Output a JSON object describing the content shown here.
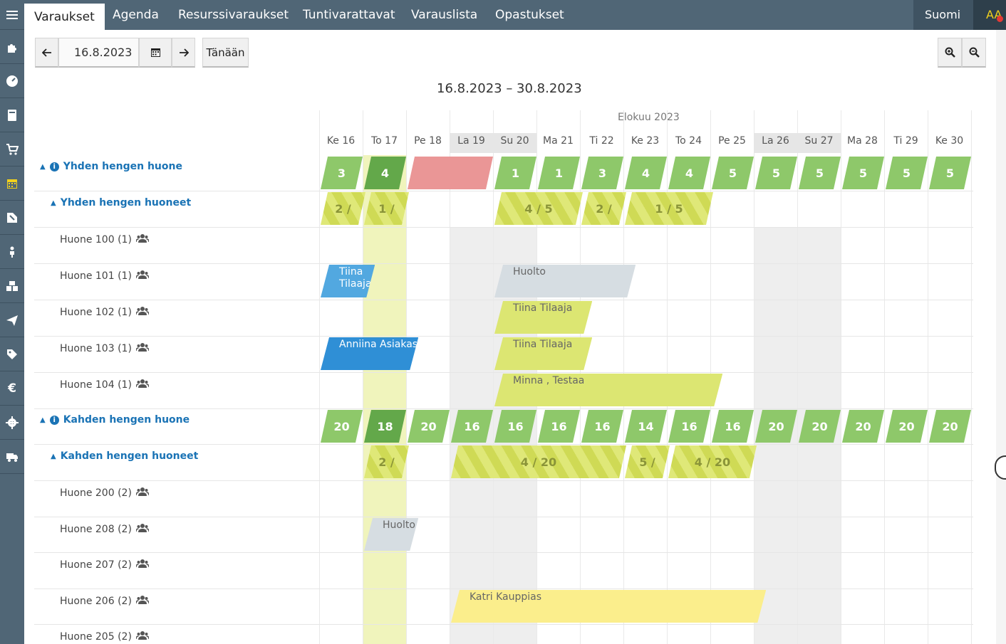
{
  "nav": {
    "tabs": [
      "Varaukset",
      "Agenda",
      "Resurssivaraukset",
      "Tuntivarattavat",
      "Varauslista",
      "Opastukset"
    ],
    "language": "Suomi",
    "user_initials": "AA"
  },
  "toolbar": {
    "date": "16.8.2023",
    "today_label": "Tänään"
  },
  "calendar": {
    "range_title": "16.8.2023 – 30.8.2023",
    "month_label": "Elokuu 2023",
    "days": [
      "Ke 16",
      "To 17",
      "Pe 18",
      "La 19",
      "Su 20",
      "Ma 21",
      "Ti 22",
      "Ke 23",
      "To 24",
      "Pe 25",
      "La 26",
      "Su 27",
      "Ma 28",
      "Ti 29",
      "Ke 30"
    ],
    "weekend_days": [
      "La 19",
      "Su 20",
      "La 26",
      "Su 27"
    ],
    "today": "To 17"
  },
  "groups": [
    {
      "label": "Yhden hengen huone",
      "availability": [
        "3",
        "4",
        "",
        "",
        "1",
        "1",
        "3",
        "4",
        "4",
        "5",
        "5",
        "5",
        "5",
        "5",
        "5"
      ],
      "subgroup": {
        "label": "Yhden hengen huoneet",
        "utilization": [
          "2 /",
          "1 /",
          "4 / 5",
          "2 /",
          "1 / 5"
        ]
      },
      "rooms": [
        "Huone 100 (1)",
        "Huone 101 (1)",
        "Huone 102 (1)",
        "Huone 103 (1)",
        "Huone 104 (1)"
      ]
    },
    {
      "label": "Kahden hengen huone",
      "availability": [
        "20",
        "18",
        "20",
        "16",
        "16",
        "16",
        "16",
        "14",
        "16",
        "16",
        "20",
        "20",
        "20",
        "20",
        "20"
      ],
      "subgroup": {
        "label": "Kahden hengen huoneet",
        "utilization": [
          "2 /",
          "4 / 20",
          "5 /",
          "4 / 20"
        ]
      },
      "rooms": [
        "Huone 200 (2)",
        "Huone 208 (2)",
        "Huone 207 (2)",
        "Huone 206 (2)",
        "Huone 205 (2)"
      ]
    }
  ],
  "bookings": [
    {
      "text": "Tiina Tilaaja",
      "kind": "blue-light"
    },
    {
      "text": "Huolto",
      "kind": "grey"
    },
    {
      "text": "Tiina Tilaaja",
      "kind": "lime"
    },
    {
      "text": "Anniina Asiakas",
      "kind": "blue"
    },
    {
      "text": "Tiina Tilaaja",
      "kind": "lime"
    },
    {
      "text": "Minna , Testaa",
      "kind": "lime"
    },
    {
      "text": "Huolto",
      "kind": "grey"
    },
    {
      "text": "Katri Kauppias",
      "kind": "yellow"
    }
  ],
  "colors": {
    "navbar": "#506676",
    "accent": "#1a73b5",
    "available": "#8ec86a",
    "full": "#ea9696"
  }
}
